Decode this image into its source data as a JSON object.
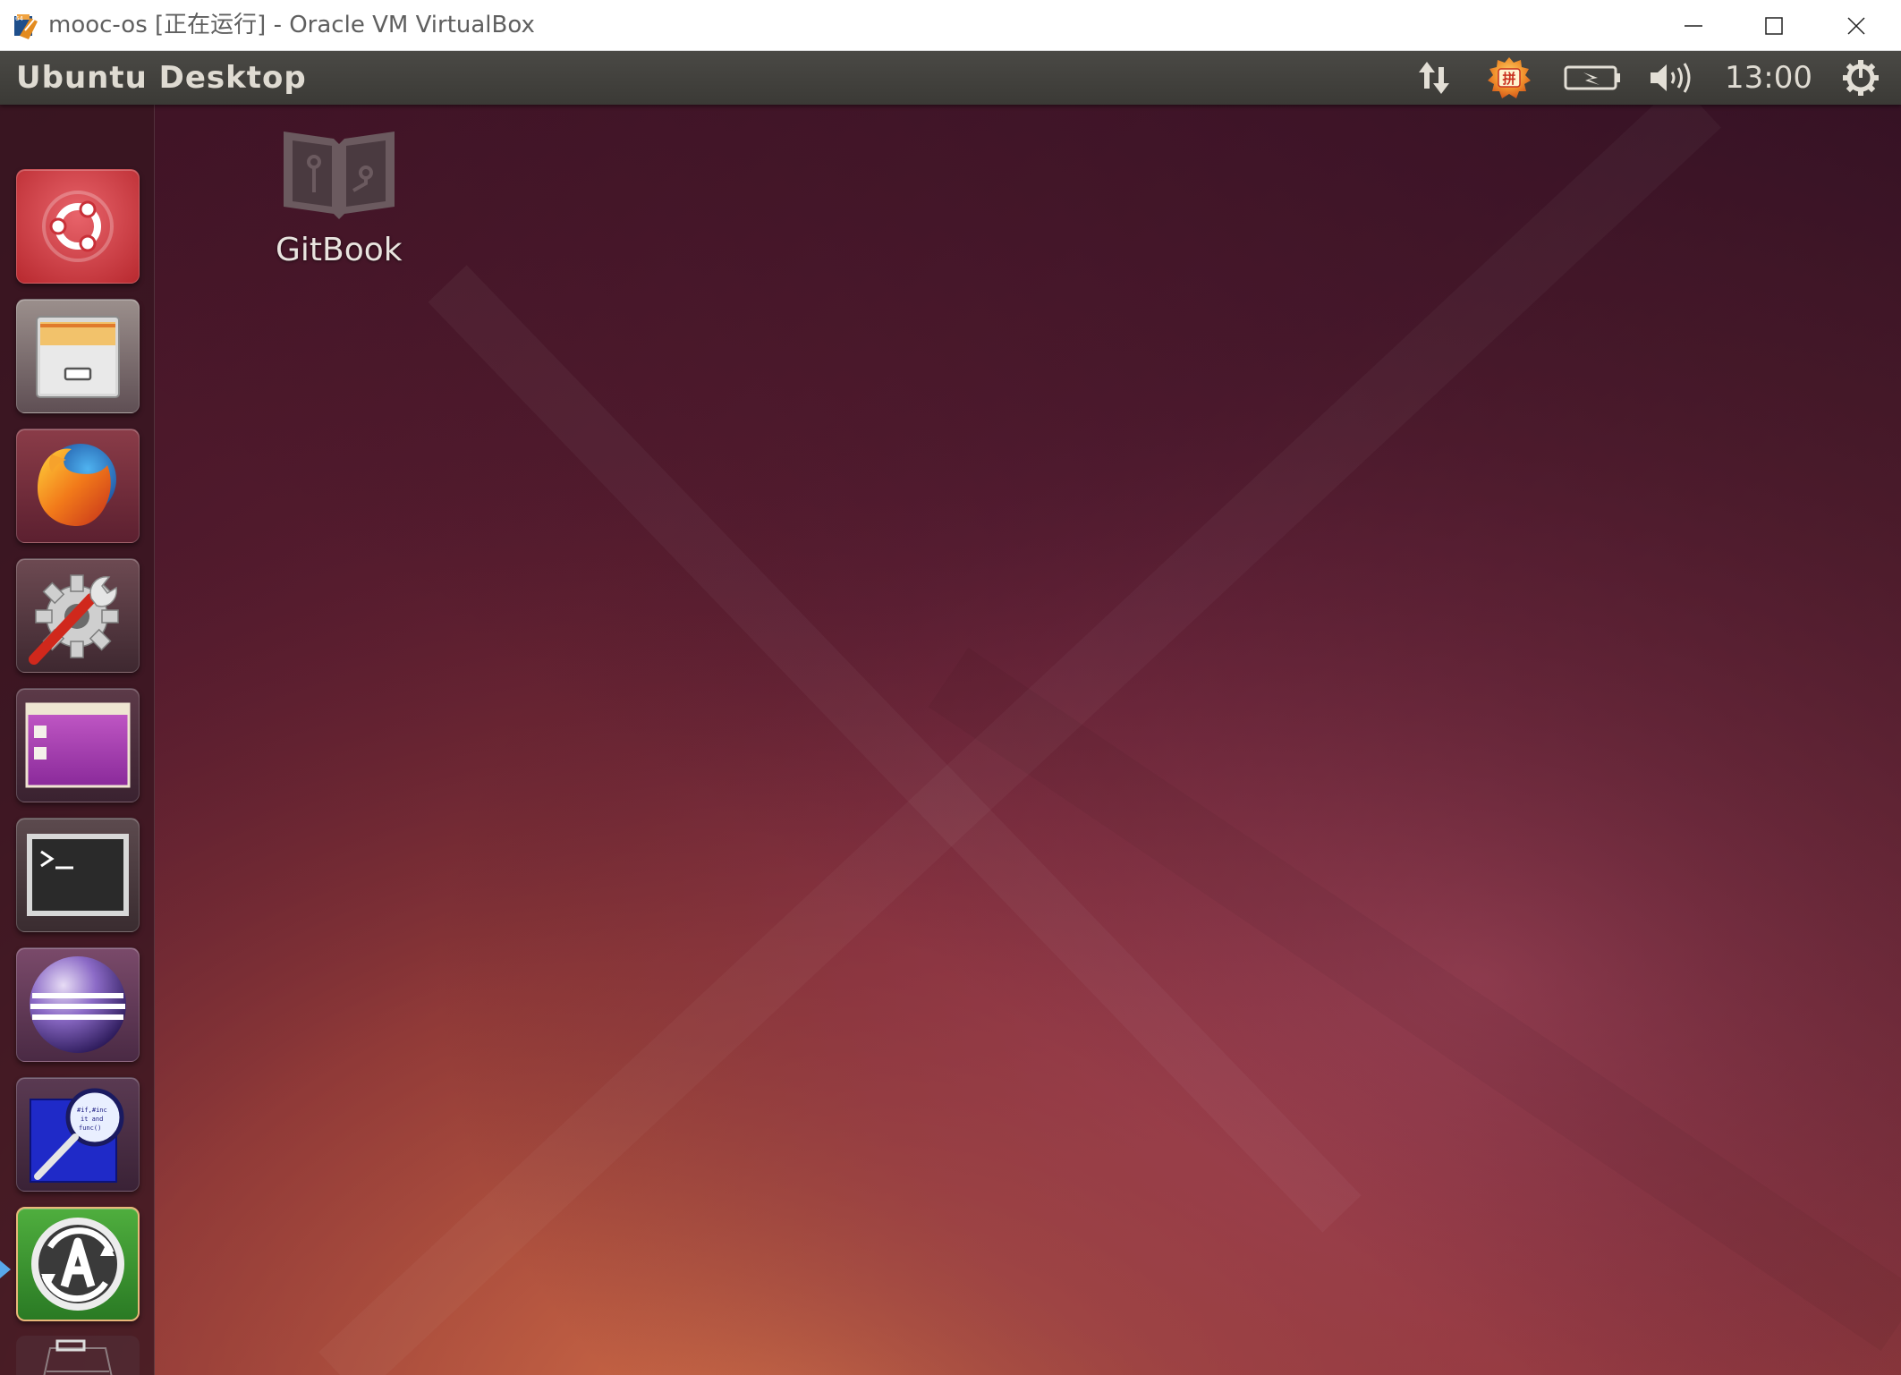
{
  "window": {
    "title": "mooc-os [正在运行] - Oracle VM VirtualBox",
    "controls": {
      "minimize": "minimize",
      "maximize": "maximize",
      "close": "close"
    }
  },
  "panel": {
    "title": "Ubuntu Desktop",
    "clock": "13:00",
    "ime_label": "拼",
    "indicators": [
      "network-icon",
      "ime-icon",
      "battery-icon",
      "volume-icon",
      "power-gear-icon"
    ]
  },
  "launcher": {
    "items": [
      {
        "name": "dash-home",
        "icon": "ubuntu-logo-icon",
        "active": false
      },
      {
        "name": "files",
        "icon": "file-cabinet-icon",
        "active": false
      },
      {
        "name": "firefox",
        "icon": "firefox-icon",
        "active": false
      },
      {
        "name": "system-settings",
        "icon": "gear-wrench-icon",
        "active": false
      },
      {
        "name": "workspaces",
        "icon": "workspace-switcher-icon",
        "active": false
      },
      {
        "name": "terminal",
        "icon": "terminal-icon",
        "active": false
      },
      {
        "name": "eclipse",
        "icon": "eclipse-icon",
        "active": false
      },
      {
        "name": "code-search",
        "icon": "magnifier-icon",
        "active": false
      },
      {
        "name": "software-updater",
        "icon": "software-updater-icon",
        "active": true
      },
      {
        "name": "trash",
        "icon": "trash-icon",
        "active": false
      }
    ]
  },
  "desktop": {
    "icons": [
      {
        "label": "GitBook",
        "icon": "book-icon"
      }
    ]
  },
  "colors": {
    "panel_bg": "#3b3a36",
    "panel_text": "#dfdbd2",
    "wallpaper_dark": "#3d1426",
    "wallpaper_orange": "#c0613f",
    "wallpaper_magenta": "#7a2848",
    "active_indicator": "#58a8ea"
  }
}
